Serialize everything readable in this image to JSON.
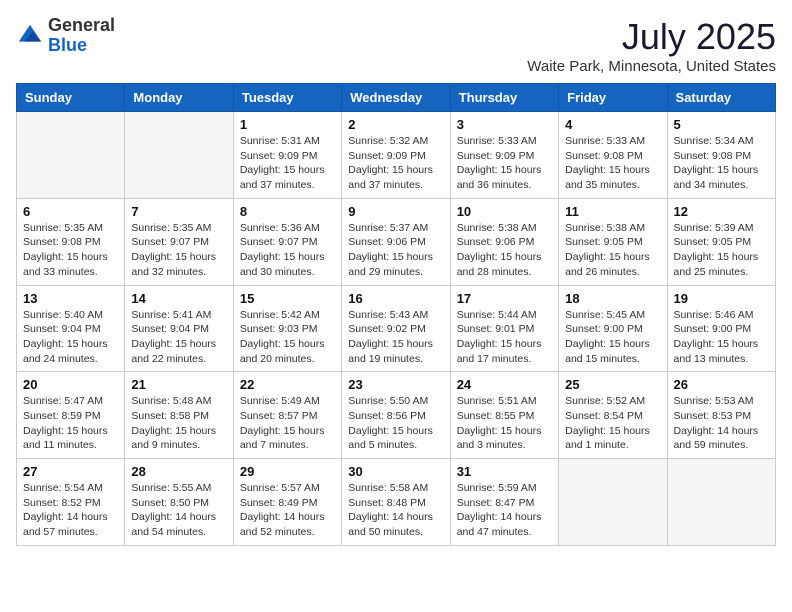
{
  "header": {
    "logo_general": "General",
    "logo_blue": "Blue",
    "month_year": "July 2025",
    "location": "Waite Park, Minnesota, United States"
  },
  "weekdays": [
    "Sunday",
    "Monday",
    "Tuesday",
    "Wednesday",
    "Thursday",
    "Friday",
    "Saturday"
  ],
  "weeks": [
    [
      {
        "num": "",
        "empty": true
      },
      {
        "num": "",
        "empty": true
      },
      {
        "num": "1",
        "sunrise": "Sunrise: 5:31 AM",
        "sunset": "Sunset: 9:09 PM",
        "daylight": "Daylight: 15 hours and 37 minutes."
      },
      {
        "num": "2",
        "sunrise": "Sunrise: 5:32 AM",
        "sunset": "Sunset: 9:09 PM",
        "daylight": "Daylight: 15 hours and 37 minutes."
      },
      {
        "num": "3",
        "sunrise": "Sunrise: 5:33 AM",
        "sunset": "Sunset: 9:09 PM",
        "daylight": "Daylight: 15 hours and 36 minutes."
      },
      {
        "num": "4",
        "sunrise": "Sunrise: 5:33 AM",
        "sunset": "Sunset: 9:08 PM",
        "daylight": "Daylight: 15 hours and 35 minutes."
      },
      {
        "num": "5",
        "sunrise": "Sunrise: 5:34 AM",
        "sunset": "Sunset: 9:08 PM",
        "daylight": "Daylight: 15 hours and 34 minutes."
      }
    ],
    [
      {
        "num": "6",
        "sunrise": "Sunrise: 5:35 AM",
        "sunset": "Sunset: 9:08 PM",
        "daylight": "Daylight: 15 hours and 33 minutes."
      },
      {
        "num": "7",
        "sunrise": "Sunrise: 5:35 AM",
        "sunset": "Sunset: 9:07 PM",
        "daylight": "Daylight: 15 hours and 32 minutes."
      },
      {
        "num": "8",
        "sunrise": "Sunrise: 5:36 AM",
        "sunset": "Sunset: 9:07 PM",
        "daylight": "Daylight: 15 hours and 30 minutes."
      },
      {
        "num": "9",
        "sunrise": "Sunrise: 5:37 AM",
        "sunset": "Sunset: 9:06 PM",
        "daylight": "Daylight: 15 hours and 29 minutes."
      },
      {
        "num": "10",
        "sunrise": "Sunrise: 5:38 AM",
        "sunset": "Sunset: 9:06 PM",
        "daylight": "Daylight: 15 hours and 28 minutes."
      },
      {
        "num": "11",
        "sunrise": "Sunrise: 5:38 AM",
        "sunset": "Sunset: 9:05 PM",
        "daylight": "Daylight: 15 hours and 26 minutes."
      },
      {
        "num": "12",
        "sunrise": "Sunrise: 5:39 AM",
        "sunset": "Sunset: 9:05 PM",
        "daylight": "Daylight: 15 hours and 25 minutes."
      }
    ],
    [
      {
        "num": "13",
        "sunrise": "Sunrise: 5:40 AM",
        "sunset": "Sunset: 9:04 PM",
        "daylight": "Daylight: 15 hours and 24 minutes."
      },
      {
        "num": "14",
        "sunrise": "Sunrise: 5:41 AM",
        "sunset": "Sunset: 9:04 PM",
        "daylight": "Daylight: 15 hours and 22 minutes."
      },
      {
        "num": "15",
        "sunrise": "Sunrise: 5:42 AM",
        "sunset": "Sunset: 9:03 PM",
        "daylight": "Daylight: 15 hours and 20 minutes."
      },
      {
        "num": "16",
        "sunrise": "Sunrise: 5:43 AM",
        "sunset": "Sunset: 9:02 PM",
        "daylight": "Daylight: 15 hours and 19 minutes."
      },
      {
        "num": "17",
        "sunrise": "Sunrise: 5:44 AM",
        "sunset": "Sunset: 9:01 PM",
        "daylight": "Daylight: 15 hours and 17 minutes."
      },
      {
        "num": "18",
        "sunrise": "Sunrise: 5:45 AM",
        "sunset": "Sunset: 9:00 PM",
        "daylight": "Daylight: 15 hours and 15 minutes."
      },
      {
        "num": "19",
        "sunrise": "Sunrise: 5:46 AM",
        "sunset": "Sunset: 9:00 PM",
        "daylight": "Daylight: 15 hours and 13 minutes."
      }
    ],
    [
      {
        "num": "20",
        "sunrise": "Sunrise: 5:47 AM",
        "sunset": "Sunset: 8:59 PM",
        "daylight": "Daylight: 15 hours and 11 minutes."
      },
      {
        "num": "21",
        "sunrise": "Sunrise: 5:48 AM",
        "sunset": "Sunset: 8:58 PM",
        "daylight": "Daylight: 15 hours and 9 minutes."
      },
      {
        "num": "22",
        "sunrise": "Sunrise: 5:49 AM",
        "sunset": "Sunset: 8:57 PM",
        "daylight": "Daylight: 15 hours and 7 minutes."
      },
      {
        "num": "23",
        "sunrise": "Sunrise: 5:50 AM",
        "sunset": "Sunset: 8:56 PM",
        "daylight": "Daylight: 15 hours and 5 minutes."
      },
      {
        "num": "24",
        "sunrise": "Sunrise: 5:51 AM",
        "sunset": "Sunset: 8:55 PM",
        "daylight": "Daylight: 15 hours and 3 minutes."
      },
      {
        "num": "25",
        "sunrise": "Sunrise: 5:52 AM",
        "sunset": "Sunset: 8:54 PM",
        "daylight": "Daylight: 15 hours and 1 minute."
      },
      {
        "num": "26",
        "sunrise": "Sunrise: 5:53 AM",
        "sunset": "Sunset: 8:53 PM",
        "daylight": "Daylight: 14 hours and 59 minutes."
      }
    ],
    [
      {
        "num": "27",
        "sunrise": "Sunrise: 5:54 AM",
        "sunset": "Sunset: 8:52 PM",
        "daylight": "Daylight: 14 hours and 57 minutes."
      },
      {
        "num": "28",
        "sunrise": "Sunrise: 5:55 AM",
        "sunset": "Sunset: 8:50 PM",
        "daylight": "Daylight: 14 hours and 54 minutes."
      },
      {
        "num": "29",
        "sunrise": "Sunrise: 5:57 AM",
        "sunset": "Sunset: 8:49 PM",
        "daylight": "Daylight: 14 hours and 52 minutes."
      },
      {
        "num": "30",
        "sunrise": "Sunrise: 5:58 AM",
        "sunset": "Sunset: 8:48 PM",
        "daylight": "Daylight: 14 hours and 50 minutes."
      },
      {
        "num": "31",
        "sunrise": "Sunrise: 5:59 AM",
        "sunset": "Sunset: 8:47 PM",
        "daylight": "Daylight: 14 hours and 47 minutes."
      },
      {
        "num": "",
        "empty": true
      },
      {
        "num": "",
        "empty": true
      }
    ]
  ]
}
